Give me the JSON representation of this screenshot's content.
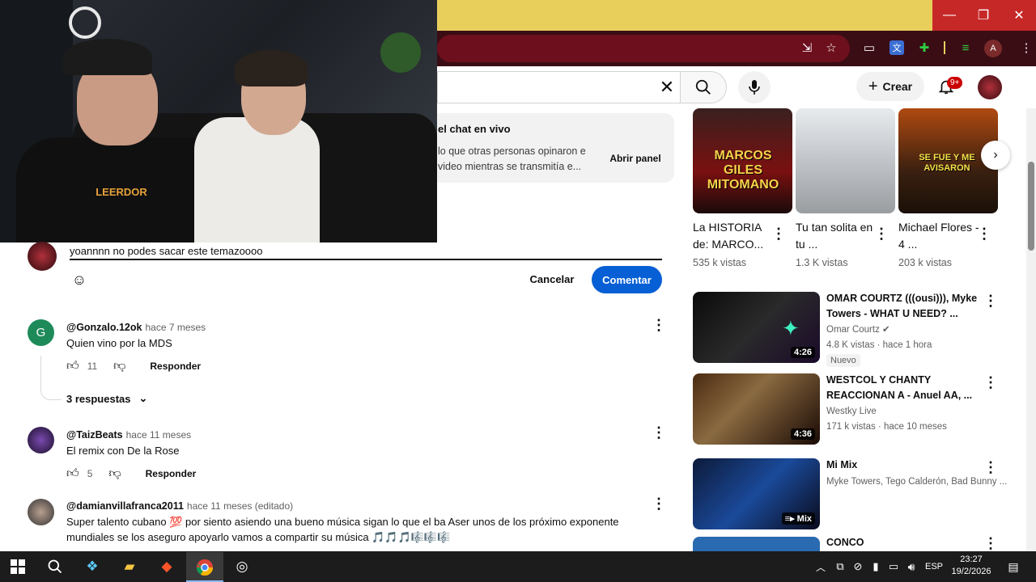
{
  "window": {
    "minimize": "—",
    "maximize": "❐",
    "close": "✕"
  },
  "browser": {
    "profile_initial": "A"
  },
  "webcam": {
    "shirt_text": "LEERDOR"
  },
  "header": {
    "create_label": "Crear",
    "notif_count": "9+"
  },
  "live_chat": {
    "title": "el chat en vivo",
    "description": "lo que otras personas opinaron e video mientras se transmitía e...",
    "open_button": "Abrir panel"
  },
  "comment_box": {
    "value": "yoannnn no podes sacar este temazoooo",
    "cancel": "Cancelar",
    "submit": "Comentar"
  },
  "comments": [
    {
      "initial": "G",
      "author": "@Gonzalo.12ok",
      "time": "hace 7 meses",
      "text": "Quien vino por la MDS",
      "likes": "11",
      "reply": "Responder",
      "replies_label": "3 respuestas",
      "avatar_color": "#1e8a5a"
    },
    {
      "initial": "",
      "author": "@TaizBeats",
      "time": "hace 11 meses",
      "text": "El remix con De la Rose",
      "likes": "5",
      "reply": "Responder",
      "avatar_color": "#4a2a6a"
    },
    {
      "initial": "",
      "author": "@damianvillafranca2011",
      "time": "hace 11 meses (editado)",
      "text": "Super talento cubano 💯 por siento asiendo una bueno música sigan lo que el ba Aser unos de los próximo exponente mundiales se los aseguro apoyarlo vamos a compartir su música 🎵🎵🎵🎼🎼🎼",
      "avatar_color": "#555555"
    }
  ],
  "shorts": [
    {
      "title": "La HISTORIA de: MARCO...",
      "views": "535 k vistas",
      "thumb_text": "MARCOS GILES MITOMANO",
      "thumb_color": "#7a1010"
    },
    {
      "title": "Tu tan solita en tu ...",
      "views": "1.3 K vistas",
      "thumb_text": "",
      "thumb_color": "#c9ccd0"
    },
    {
      "title": "Michael Flores - 4 ...",
      "views": "203 k vistas",
      "thumb_text": "SE FUE Y ME AVISARON",
      "thumb_color": "#7a3a10"
    }
  ],
  "videos": [
    {
      "title": "OMAR COURTZ (((ousi))), Myke Towers - WHAT U NEED? ...",
      "channel": "Omar Courtz",
      "meta": "4.8 K vistas · hace 1 hora",
      "duration": "4:26",
      "badge": "Nuevo",
      "thumb_color": "#151515"
    },
    {
      "title": "WESTCOL Y CHANTY REACCIONAN A - Anuel AA, ...",
      "channel": "Westky Live",
      "meta": "171 k vistas · hace 10 meses",
      "duration": "4:36",
      "thumb_color": "#3a2010"
    },
    {
      "title": "Mi Mix",
      "channel": "Myke Towers, Tego Calderón, Bad Bunny ...",
      "duration": "Mix",
      "thumb_color": "#0d2a5a"
    },
    {
      "title": "CONCO",
      "thumb_color": "#2a6ab0"
    }
  ],
  "taskbar": {
    "lang": "ESP",
    "time": "23:27",
    "date": "19/2/2026"
  }
}
